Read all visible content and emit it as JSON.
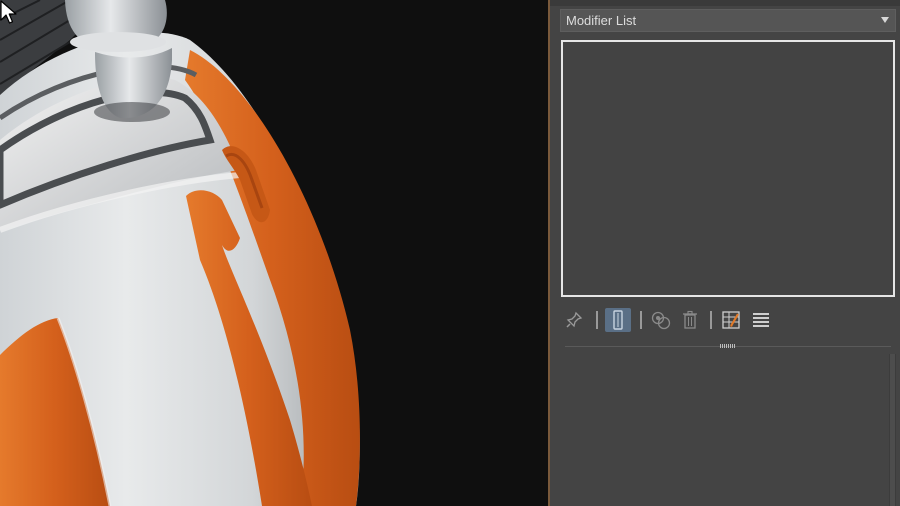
{
  "panel": {
    "modifier_list_label": "Modifier List"
  },
  "toolbar": {
    "buttons": [
      {
        "icon": "pin-stack-icon",
        "active": false
      },
      {
        "icon": "show-end-result-icon",
        "active": true
      },
      {
        "icon": "make-unique-icon",
        "active": false
      },
      {
        "icon": "remove-modifier-icon",
        "active": false
      },
      {
        "icon": "configure-modifier-sets-icon",
        "active": false
      },
      {
        "icon": "list-icon",
        "active": false
      }
    ]
  },
  "colors": {
    "viewport_background": "#0f0f0f",
    "panel_background": "#444444",
    "model_orange": "#d4601c",
    "model_white": "#dcdcdc",
    "active_button": "#5a6f86",
    "divider": "#7a5a3c"
  }
}
